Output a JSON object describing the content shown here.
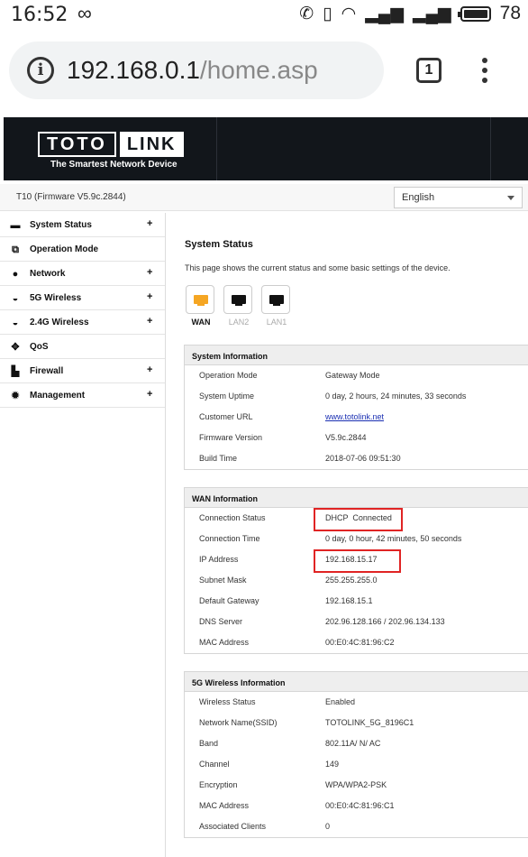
{
  "status_bar": {
    "time": "16:52",
    "battery": "78"
  },
  "browser": {
    "url_host": "192.168.0.1",
    "url_path": "/home.asp",
    "tab_count": "1"
  },
  "router": {
    "logo_left": "TOTO",
    "logo_right": "LINK",
    "tagline": "The Smartest Network Device",
    "model": "T10 (Firmware V5.9c.2844)",
    "language": "English"
  },
  "sidebar": {
    "items": [
      {
        "label": "System Status",
        "icon": "chat-icon",
        "expand": "+"
      },
      {
        "label": "Operation Mode",
        "icon": "window-icon",
        "expand": ""
      },
      {
        "label": "Network",
        "icon": "globe-icon",
        "expand": "+"
      },
      {
        "label": "5G Wireless",
        "icon": "wifi-icon",
        "expand": "+"
      },
      {
        "label": "2.4G Wireless",
        "icon": "wifi-icon",
        "expand": "+"
      },
      {
        "label": "QoS",
        "icon": "diamond-icon",
        "expand": ""
      },
      {
        "label": "Firewall",
        "icon": "lock-icon",
        "expand": "+"
      },
      {
        "label": "Management",
        "icon": "gear-icon",
        "expand": "+"
      }
    ]
  },
  "main": {
    "title": "System Status",
    "description": "This page shows the current status and some basic settings of the device.",
    "ports": [
      {
        "label": "WAN",
        "active": true
      },
      {
        "label": "LAN2",
        "active": false
      },
      {
        "label": "LAN1",
        "active": false
      }
    ],
    "system_info": {
      "title": "System Information",
      "rows": [
        {
          "k": "Operation Mode",
          "v": "Gateway Mode"
        },
        {
          "k": "System Uptime",
          "v": "0 day, 2 hours, 24 minutes, 33 seconds"
        },
        {
          "k": "Customer URL",
          "v": "www.totolink.net"
        },
        {
          "k": "Firmware Version",
          "v": "V5.9c.2844"
        },
        {
          "k": "Build Time",
          "v": "2018-07-06 09:51:30"
        }
      ]
    },
    "wan_info": {
      "title": "WAN Information",
      "rows": [
        {
          "k": "Connection Status",
          "v": "DHCP  Connected"
        },
        {
          "k": "Connection Time",
          "v": "0 day, 0 hour, 42 minutes, 50 seconds"
        },
        {
          "k": "IP Address",
          "v": "192.168.15.17"
        },
        {
          "k": "Subnet Mask",
          "v": "255.255.255.0"
        },
        {
          "k": "Default Gateway",
          "v": "192.168.15.1"
        },
        {
          "k": "DNS Server",
          "v": "202.96.128.166 / 202.96.134.133"
        },
        {
          "k": "MAC Address",
          "v": "00:E0:4C:81:96:C2"
        }
      ]
    },
    "wireless_5g": {
      "title": "5G Wireless Information",
      "rows": [
        {
          "k": "Wireless Status",
          "v": "Enabled"
        },
        {
          "k": "Network Name(SSID)",
          "v": "TOTOLINK_5G_8196C1"
        },
        {
          "k": "Band",
          "v": "802.11A/ N/ AC"
        },
        {
          "k": "Channel",
          "v": "149"
        },
        {
          "k": "Encryption",
          "v": "WPA/WPA2-PSK"
        },
        {
          "k": "MAC Address",
          "v": "00:E0:4C:81:96:C1"
        },
        {
          "k": "Associated Clients",
          "v": "0"
        }
      ]
    }
  },
  "colors": {
    "header_dark": "#12161b",
    "highlight_red": "#e02424",
    "wan_port_active": "#f5a623",
    "link_blue": "#1a2fb2"
  }
}
